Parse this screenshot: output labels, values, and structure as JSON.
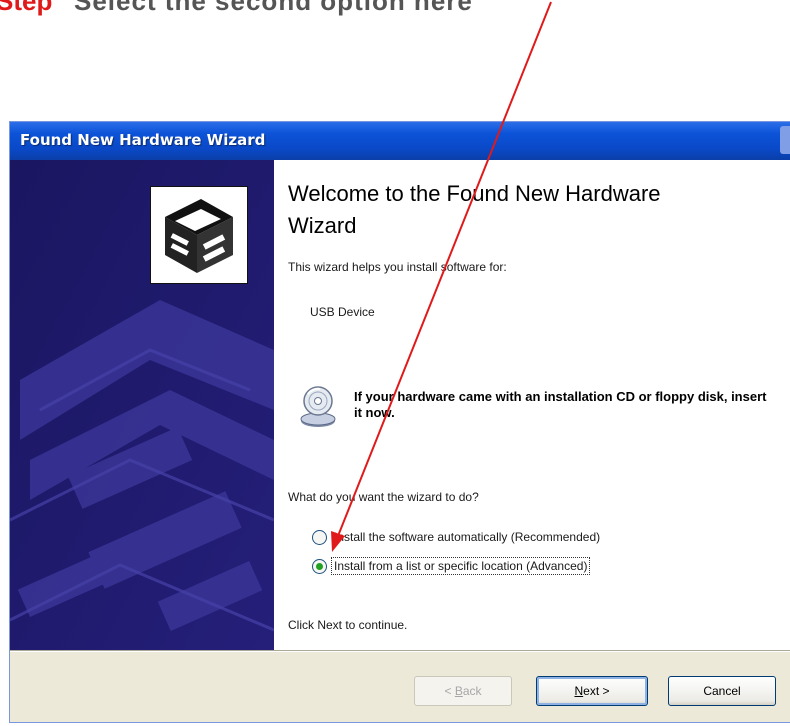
{
  "annotation": {
    "red_text": "Step",
    "dark_text": "Select  the  second  option  here",
    "arrow_color": "#e01a1a"
  },
  "window": {
    "title": "Found New Hardware Wizard",
    "titlebar_color": "#0a49c8"
  },
  "banner": {
    "background_color": "#1e1a6a",
    "icon": "hardware-wizard-icon"
  },
  "content": {
    "heading": "Welcome to the Found New Hardware Wizard",
    "intro": "This wizard helps you install software for:",
    "device_name": "USB Device",
    "cd_icon": "cd-disk-icon",
    "cd_hint": "If your hardware came with an installation CD or floppy disk, insert it now.",
    "question": "What do you want the wizard to do?",
    "options": [
      {
        "label": "Install the software automatically (Recommended)",
        "selected": false
      },
      {
        "label": "Install from a list or specific location (Advanced)",
        "selected": true
      }
    ],
    "continue_hint": "Click Next to continue."
  },
  "buttons": {
    "back": {
      "prefix": "< ",
      "mnemonic": "B",
      "rest": "ack",
      "enabled": false
    },
    "next": {
      "mnemonic": "N",
      "rest": "ext >",
      "enabled": true
    },
    "cancel": {
      "label": "Cancel",
      "enabled": true
    }
  }
}
